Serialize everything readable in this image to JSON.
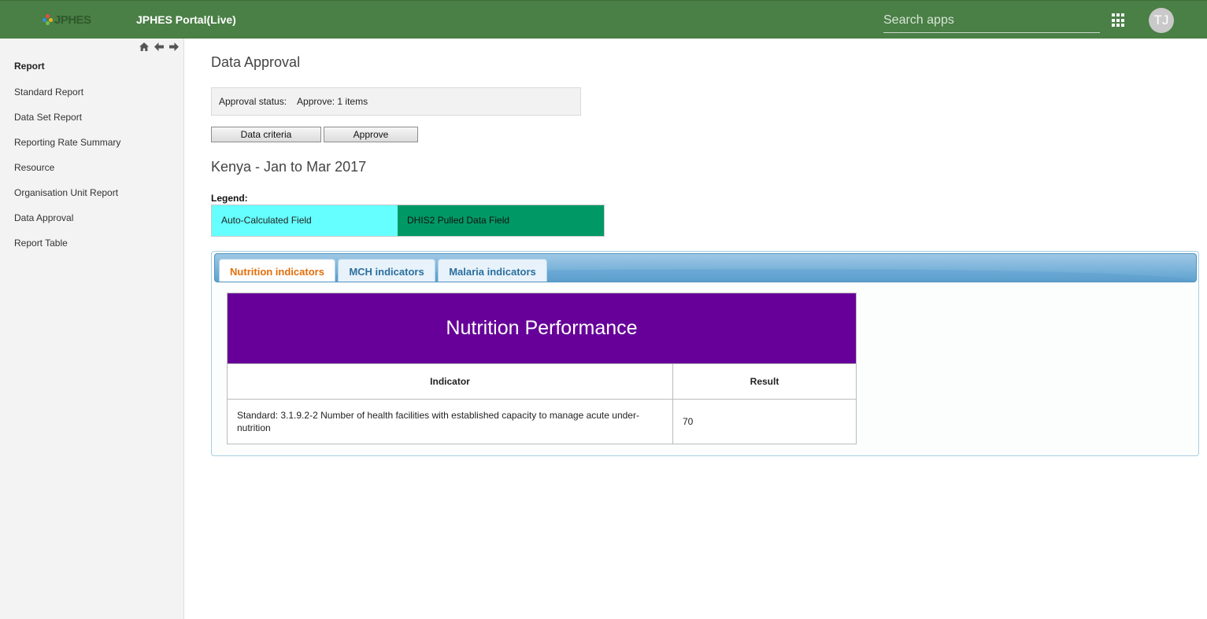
{
  "header": {
    "logo_text": "JPHES",
    "app_title": "JPHES Portal(Live)",
    "search_placeholder": "Search apps",
    "apps_icon": "apps-grid-icon",
    "avatar_initials": "TJ",
    "colors": {
      "bar": "#4a7f46"
    }
  },
  "sidebar": {
    "nav_icons": [
      "home-icon",
      "arrow-left-icon",
      "arrow-right-icon"
    ],
    "header": "Report",
    "items": [
      {
        "label": "Standard Report"
      },
      {
        "label": "Data Set Report"
      },
      {
        "label": "Reporting Rate Summary"
      },
      {
        "label": "Resource"
      },
      {
        "label": "Organisation Unit Report"
      },
      {
        "label": "Data Approval"
      },
      {
        "label": "Report Table"
      }
    ]
  },
  "main": {
    "title": "Data Approval",
    "approval_status_label": "Approval status:",
    "approval_status_value": "Approve: 1 items",
    "buttons": {
      "criteria": "Data criteria",
      "approve": "Approve"
    },
    "report_title": "Kenya - Jan to Mar 2017",
    "legend": {
      "label": "Legend:",
      "auto_calculated": "Auto-Calculated Field",
      "dhis2_pulled": "DHIS2 Pulled Data Field",
      "colors": {
        "auto": "#66ffff",
        "pulled": "#009966"
      }
    },
    "tabs": [
      {
        "label": "Nutrition indicators",
        "active": true
      },
      {
        "label": "MCH indicators",
        "active": false
      },
      {
        "label": "Malaria indicators",
        "active": false
      }
    ],
    "table": {
      "banner": "Nutrition Performance",
      "banner_color": "#660099",
      "columns": [
        "Indicator",
        "Result"
      ],
      "rows": [
        {
          "indicator": "Standard: 3.1.9.2-2 Number of health facilities with established capacity to manage acute under-nutrition",
          "result": "70"
        }
      ]
    }
  }
}
